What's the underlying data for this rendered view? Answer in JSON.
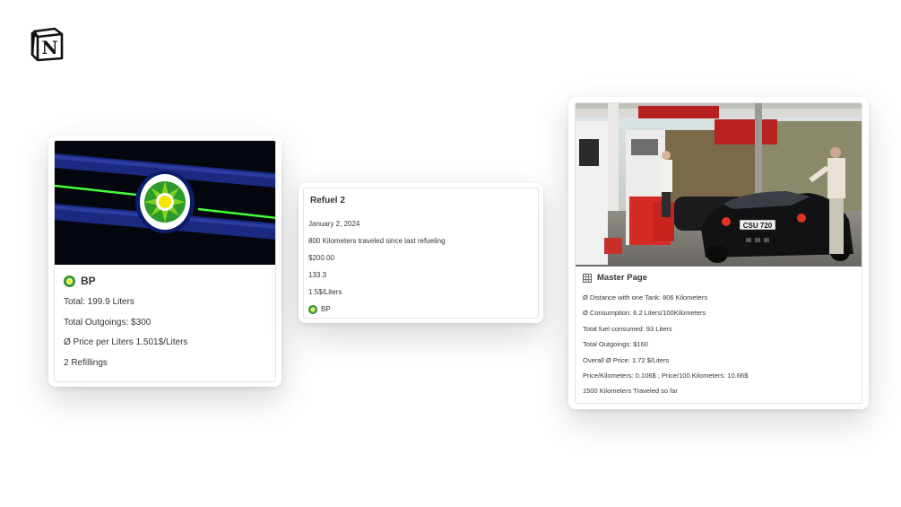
{
  "brand": {
    "logo_icon": "notion-logo-icon",
    "logo_letter": "N"
  },
  "bp_card": {
    "image_icon": "bp-station-sign-image",
    "title_icon": "bp-logo-icon",
    "title": "BP",
    "lines": [
      "Total: 199.9 Liters",
      "Total Outgoings: $300",
      "Ø Price per Liters 1.501$/Liters",
      "2 Refillings"
    ]
  },
  "refuel_card": {
    "title": "Refuel 2",
    "date": "January 2, 2024",
    "distance": "800 Kilometers traveled since last refueling",
    "amount": "$200.00",
    "liters": "133.3",
    "price": "1.5$/Liters",
    "station_icon": "bp-logo-icon",
    "station": "BP"
  },
  "master_card": {
    "image_icon": "gas-station-sports-car-photo",
    "title_icon": "table-grid-icon",
    "title": "Master Page",
    "plate_text": "CSU 720",
    "lines": [
      "Ø Distance with one Tank: 806 Kilometers",
      "Ø Consumption: 6.2 Liters/100Kilometers",
      "Total fuel consumed: 93 Liters",
      "Total Outgoings: $160",
      "Overall Ø Price: 1.72 $/Liters",
      "Price/Kilometers: 0.106$ ; Price/100 Kilometers: 10.66$",
      "1500 Kilometers Traveled so far"
    ]
  }
}
